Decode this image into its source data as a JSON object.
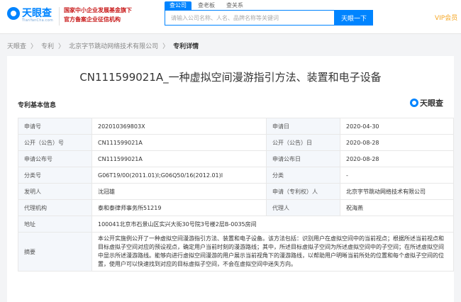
{
  "header": {
    "logo_text": "天眼查",
    "logo_sub": "TianYanCha.com",
    "gov_line1": "国家中小企业发展基金旗下",
    "gov_line2": "官方备案企业征信机构",
    "search_tabs": [
      "查公司",
      "查老板",
      "查关系"
    ],
    "active_tab": "查公司",
    "search_placeholder": "请输入公司名称、人名、品牌名称等关键词",
    "search_button": "天眼一下",
    "vip_label": "VIP会员"
  },
  "breadcrumb": [
    "天眼查",
    "专利",
    "北京字节跳动网络技术有限公司",
    "专利详情"
  ],
  "patent": {
    "title": "CN111599021A_一种虚拟空间漫游指引方法、装置和电子设备",
    "section_title": "专利基本信息",
    "watermark": "天眼查",
    "rows": [
      {
        "label1": "申请号",
        "value1": "202010369803X",
        "label2": "申请日",
        "value2": "2020-04-30"
      },
      {
        "label1": "公开（公告）号",
        "value1": "CN111599021A",
        "label2": "公开（公告）日",
        "value2": "2020-08-28"
      },
      {
        "label1": "申请公布号",
        "value1": "CN111599021A",
        "label2": "申请公布日",
        "value2": "2020-08-28"
      },
      {
        "label1": "分类号",
        "value1": "G06T19/00(2011.01)I;G06Q50/16(2012.01)I",
        "label2": "分类",
        "value2": "-"
      },
      {
        "label1": "发明人",
        "value1": "沈冠雄",
        "label2": "申请（专利权）人",
        "value2": "北京字节跳动网络技术有限公司"
      },
      {
        "label1": "代理机构",
        "value1": "泰和泰律师事务所51219",
        "label2": "代理人",
        "value2": "祝海燕"
      }
    ],
    "address_label": "地址",
    "address": "100041北京市石景山区实兴大街30号院3号楼2层B-0035房间",
    "abstract_label": "摘要",
    "abstract": "本公开实施例公开了一种虚拟空间漫游指引方法、装置和电子设备。该方法包括：识别用户在虚拟空间中的当前视点；根据所述当前视点和目标虚拟子空间对应的预设视点，确定用户当前时刻的漫游路线；其中，所述目标虚拟子空间为所述虚拟空间中的子空间；在所述虚拟空间中显示所述漫游路线。能够向进行虚拟空间漫游的用户展示当前视角下的漫游路线，以帮助用户明晰当前所处的位置和每个虚拟子空间的位置，使用户可以快速找到对应的目标虚拟子空间，不会在虚拟空间中迷失方向。"
  }
}
